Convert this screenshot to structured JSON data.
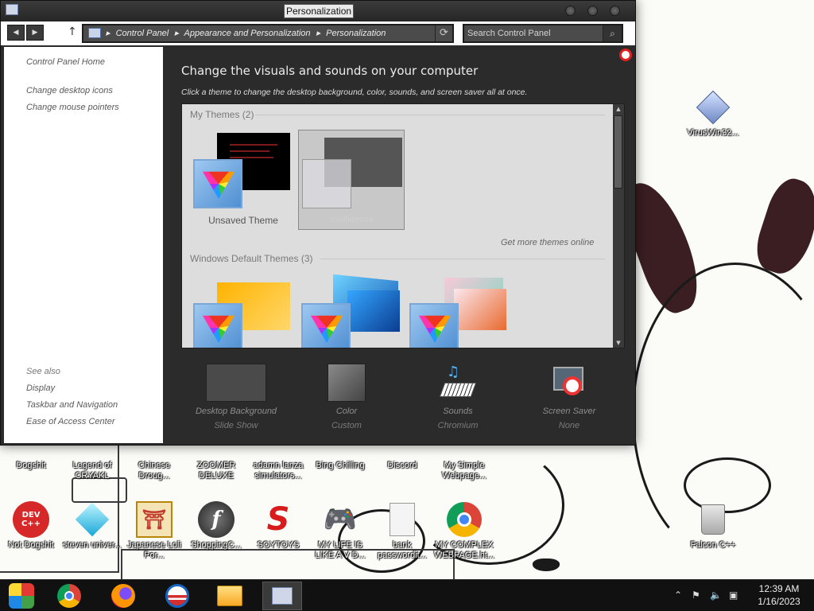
{
  "window": {
    "title": "Personalization",
    "breadcrumbs": [
      "Control Panel",
      "Appearance and Personalization",
      "Personalization"
    ],
    "search_placeholder": "Search Control Panel"
  },
  "left_pane": {
    "home_link": "Control Panel Home",
    "links": [
      "Change desktop icons",
      "Change mouse pointers"
    ],
    "see_also_header": "See also",
    "see_also_links": [
      "Display",
      "Taskbar and Navigation",
      "Ease of Access Center"
    ]
  },
  "main": {
    "title": "Change the visuals and sounds on your computer",
    "subtitle": "Click a theme to change the desktop background, color, sounds, and screen saver all at once.",
    "my_themes_header": "My Themes (2)",
    "my_themes": [
      {
        "name": "Unsaved Theme"
      },
      {
        "name": "confidence"
      }
    ],
    "get_more_link": "Get more themes online",
    "default_themes_header": "Windows Default Themes (3)",
    "bottom_bar": [
      {
        "label": "Desktop Background",
        "value": "Slide Show",
        "icon": "desktop-background-icon"
      },
      {
        "label": "Color",
        "value": "Custom",
        "icon": "color-icon"
      },
      {
        "label": "Sounds",
        "value": "Chromium",
        "icon": "sounds-icon"
      },
      {
        "label": "Screen Saver",
        "value": "None",
        "icon": "screen-saver-icon"
      }
    ]
  },
  "desktop_icons_row1": [
    {
      "label": "Dogshit"
    },
    {
      "label": "Legend of CRYAKL"
    },
    {
      "label": "Chinese Droug..."
    },
    {
      "label": "ZOOMER DELUXE"
    },
    {
      "label": "adamn lanza simulators..."
    },
    {
      "label": "Bing Chilling"
    },
    {
      "label": "Discord"
    },
    {
      "label": "My Simple Webpage..."
    }
  ],
  "desktop_icons_row2": [
    {
      "label": "Not Dogshit",
      "icon": "dev-cpp-icon",
      "badge": "DEV C++"
    },
    {
      "label": "steven univer...",
      "icon": "diamond-icon"
    },
    {
      "label": "Japanese Loli Por...",
      "icon": "torii-icon"
    },
    {
      "label": "ShoppingC...",
      "icon": "flash-icon"
    },
    {
      "label": "SOYTOYS",
      "icon": "s-logo-icon"
    },
    {
      "label": "MY LIFE IS LIKE A V D...",
      "icon": "gamepad-icon"
    },
    {
      "label": "bank passwordit...",
      "icon": "file-icon"
    },
    {
      "label": "MY COMPLEX WEBPAGE.ht...",
      "icon": "chrome-icon"
    }
  ],
  "desktop_right_icons": [
    {
      "label": "VirusWin32...",
      "icon": "virus-icon"
    },
    {
      "label": "Falcon C++",
      "icon": "recycle-bin-icon"
    }
  ],
  "taskbar": {
    "items": [
      "windows-start-icon",
      "chrome-icon",
      "firefox-icon",
      "obama-icon",
      "file-explorer-icon",
      "control-panel-icon"
    ],
    "time": "12:39 AM",
    "date": "1/16/2023"
  },
  "colors": {
    "window_bg": "#2b2b2b",
    "titlebar": "#262626",
    "taskbar": "#111111",
    "link_gray": "#5a5a5a"
  }
}
